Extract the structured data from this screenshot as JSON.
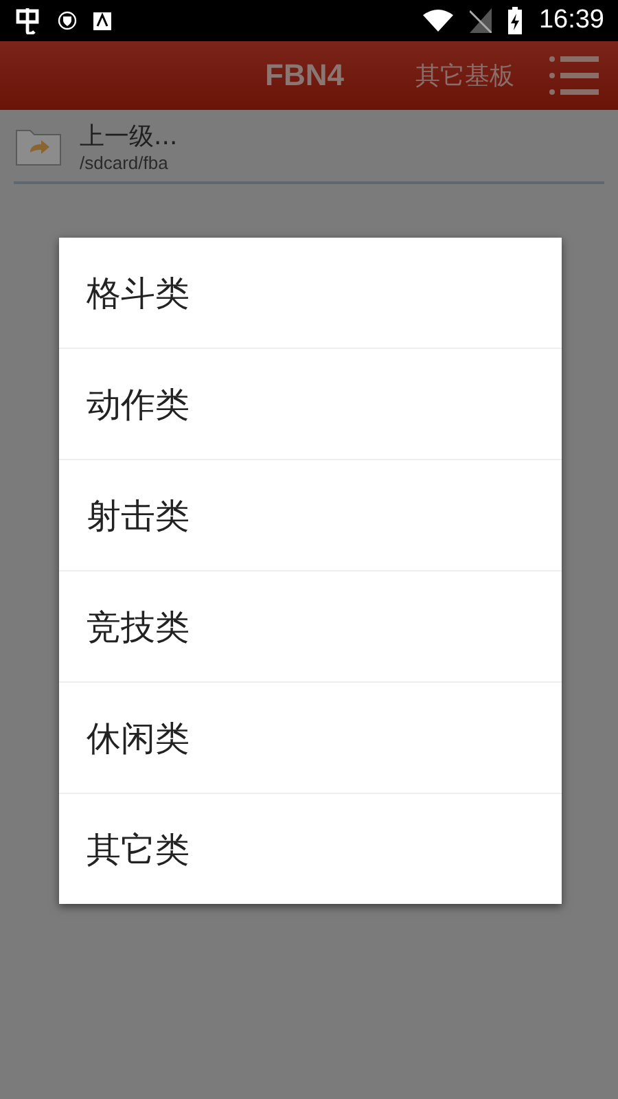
{
  "status_bar": {
    "time": "16:39"
  },
  "toolbar": {
    "title": "FBN4",
    "action": "其它基板"
  },
  "file_list": [
    {
      "name": "上一级...",
      "path": "/sdcard/fba"
    }
  ],
  "dialog": {
    "items": [
      {
        "label": "格斗类"
      },
      {
        "label": "动作类"
      },
      {
        "label": "射击类"
      },
      {
        "label": "竞技类"
      },
      {
        "label": "休闲类"
      },
      {
        "label": "其它类"
      }
    ]
  }
}
